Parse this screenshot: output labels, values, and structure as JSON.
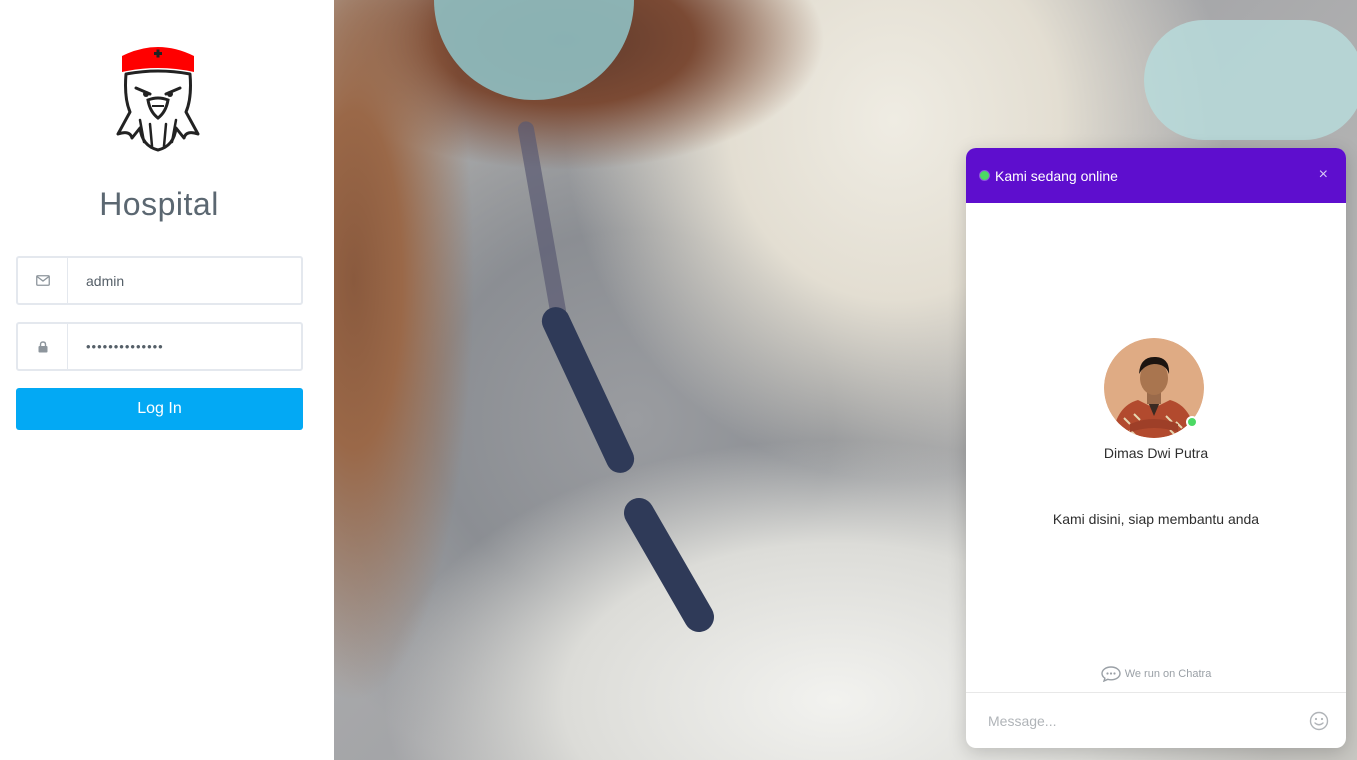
{
  "login": {
    "app_title": "Hospital",
    "email": {
      "value": "admin",
      "icon": "envelope-icon"
    },
    "password": {
      "value": "••••••••••••••",
      "icon": "lock-icon"
    },
    "login_button": "Log In",
    "colors": {
      "button": "#03a9f4",
      "logo_cap": "#ff0000"
    }
  },
  "chat": {
    "header_title": "Kami sedang online",
    "close_label": "×",
    "agent_name": "Dimas Dwi Putra",
    "greeting": "Kami disini, siap membantu anda",
    "powered_by": "We run on Chatra",
    "message_placeholder": "Message...",
    "colors": {
      "header": "#5e0ece",
      "online": "#4cd964"
    }
  }
}
